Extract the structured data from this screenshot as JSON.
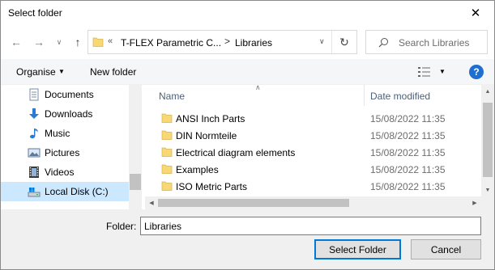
{
  "window": {
    "title": "Select folder"
  },
  "address": {
    "overflow": "«",
    "segments": [
      "T-FLEX Parametric C...",
      "Libraries"
    ],
    "separator": ">"
  },
  "search": {
    "placeholder": "Search Libraries"
  },
  "toolbar": {
    "organise": "Organise",
    "new_folder": "New folder",
    "help": "?"
  },
  "nav_pane": {
    "items": [
      {
        "label": "Documents",
        "icon": "documents-icon"
      },
      {
        "label": "Downloads",
        "icon": "downloads-icon"
      },
      {
        "label": "Music",
        "icon": "music-icon"
      },
      {
        "label": "Pictures",
        "icon": "pictures-icon"
      },
      {
        "label": "Videos",
        "icon": "videos-icon"
      },
      {
        "label": "Local Disk (C:)",
        "icon": "local-disk-icon",
        "selected": true
      }
    ]
  },
  "file_list": {
    "columns": {
      "name": "Name",
      "date": "Date modified"
    },
    "rows": [
      {
        "name": "ANSI Inch Parts",
        "date": "15/08/2022 11:35"
      },
      {
        "name": "DIN Normteile",
        "date": "15/08/2022 11:35"
      },
      {
        "name": "Electrical diagram elements",
        "date": "15/08/2022 11:35"
      },
      {
        "name": "Examples",
        "date": "15/08/2022 11:35"
      },
      {
        "name": "ISO Metric Parts",
        "date": "15/08/2022 11:35"
      }
    ]
  },
  "footer": {
    "folder_label": "Folder:",
    "folder_value": "Libraries",
    "select_button": "Select Folder",
    "cancel_button": "Cancel"
  },
  "colors": {
    "accent": "#0078d7",
    "selection": "#cce8ff",
    "folder": "#f8d775",
    "help": "#1e6fd0"
  }
}
